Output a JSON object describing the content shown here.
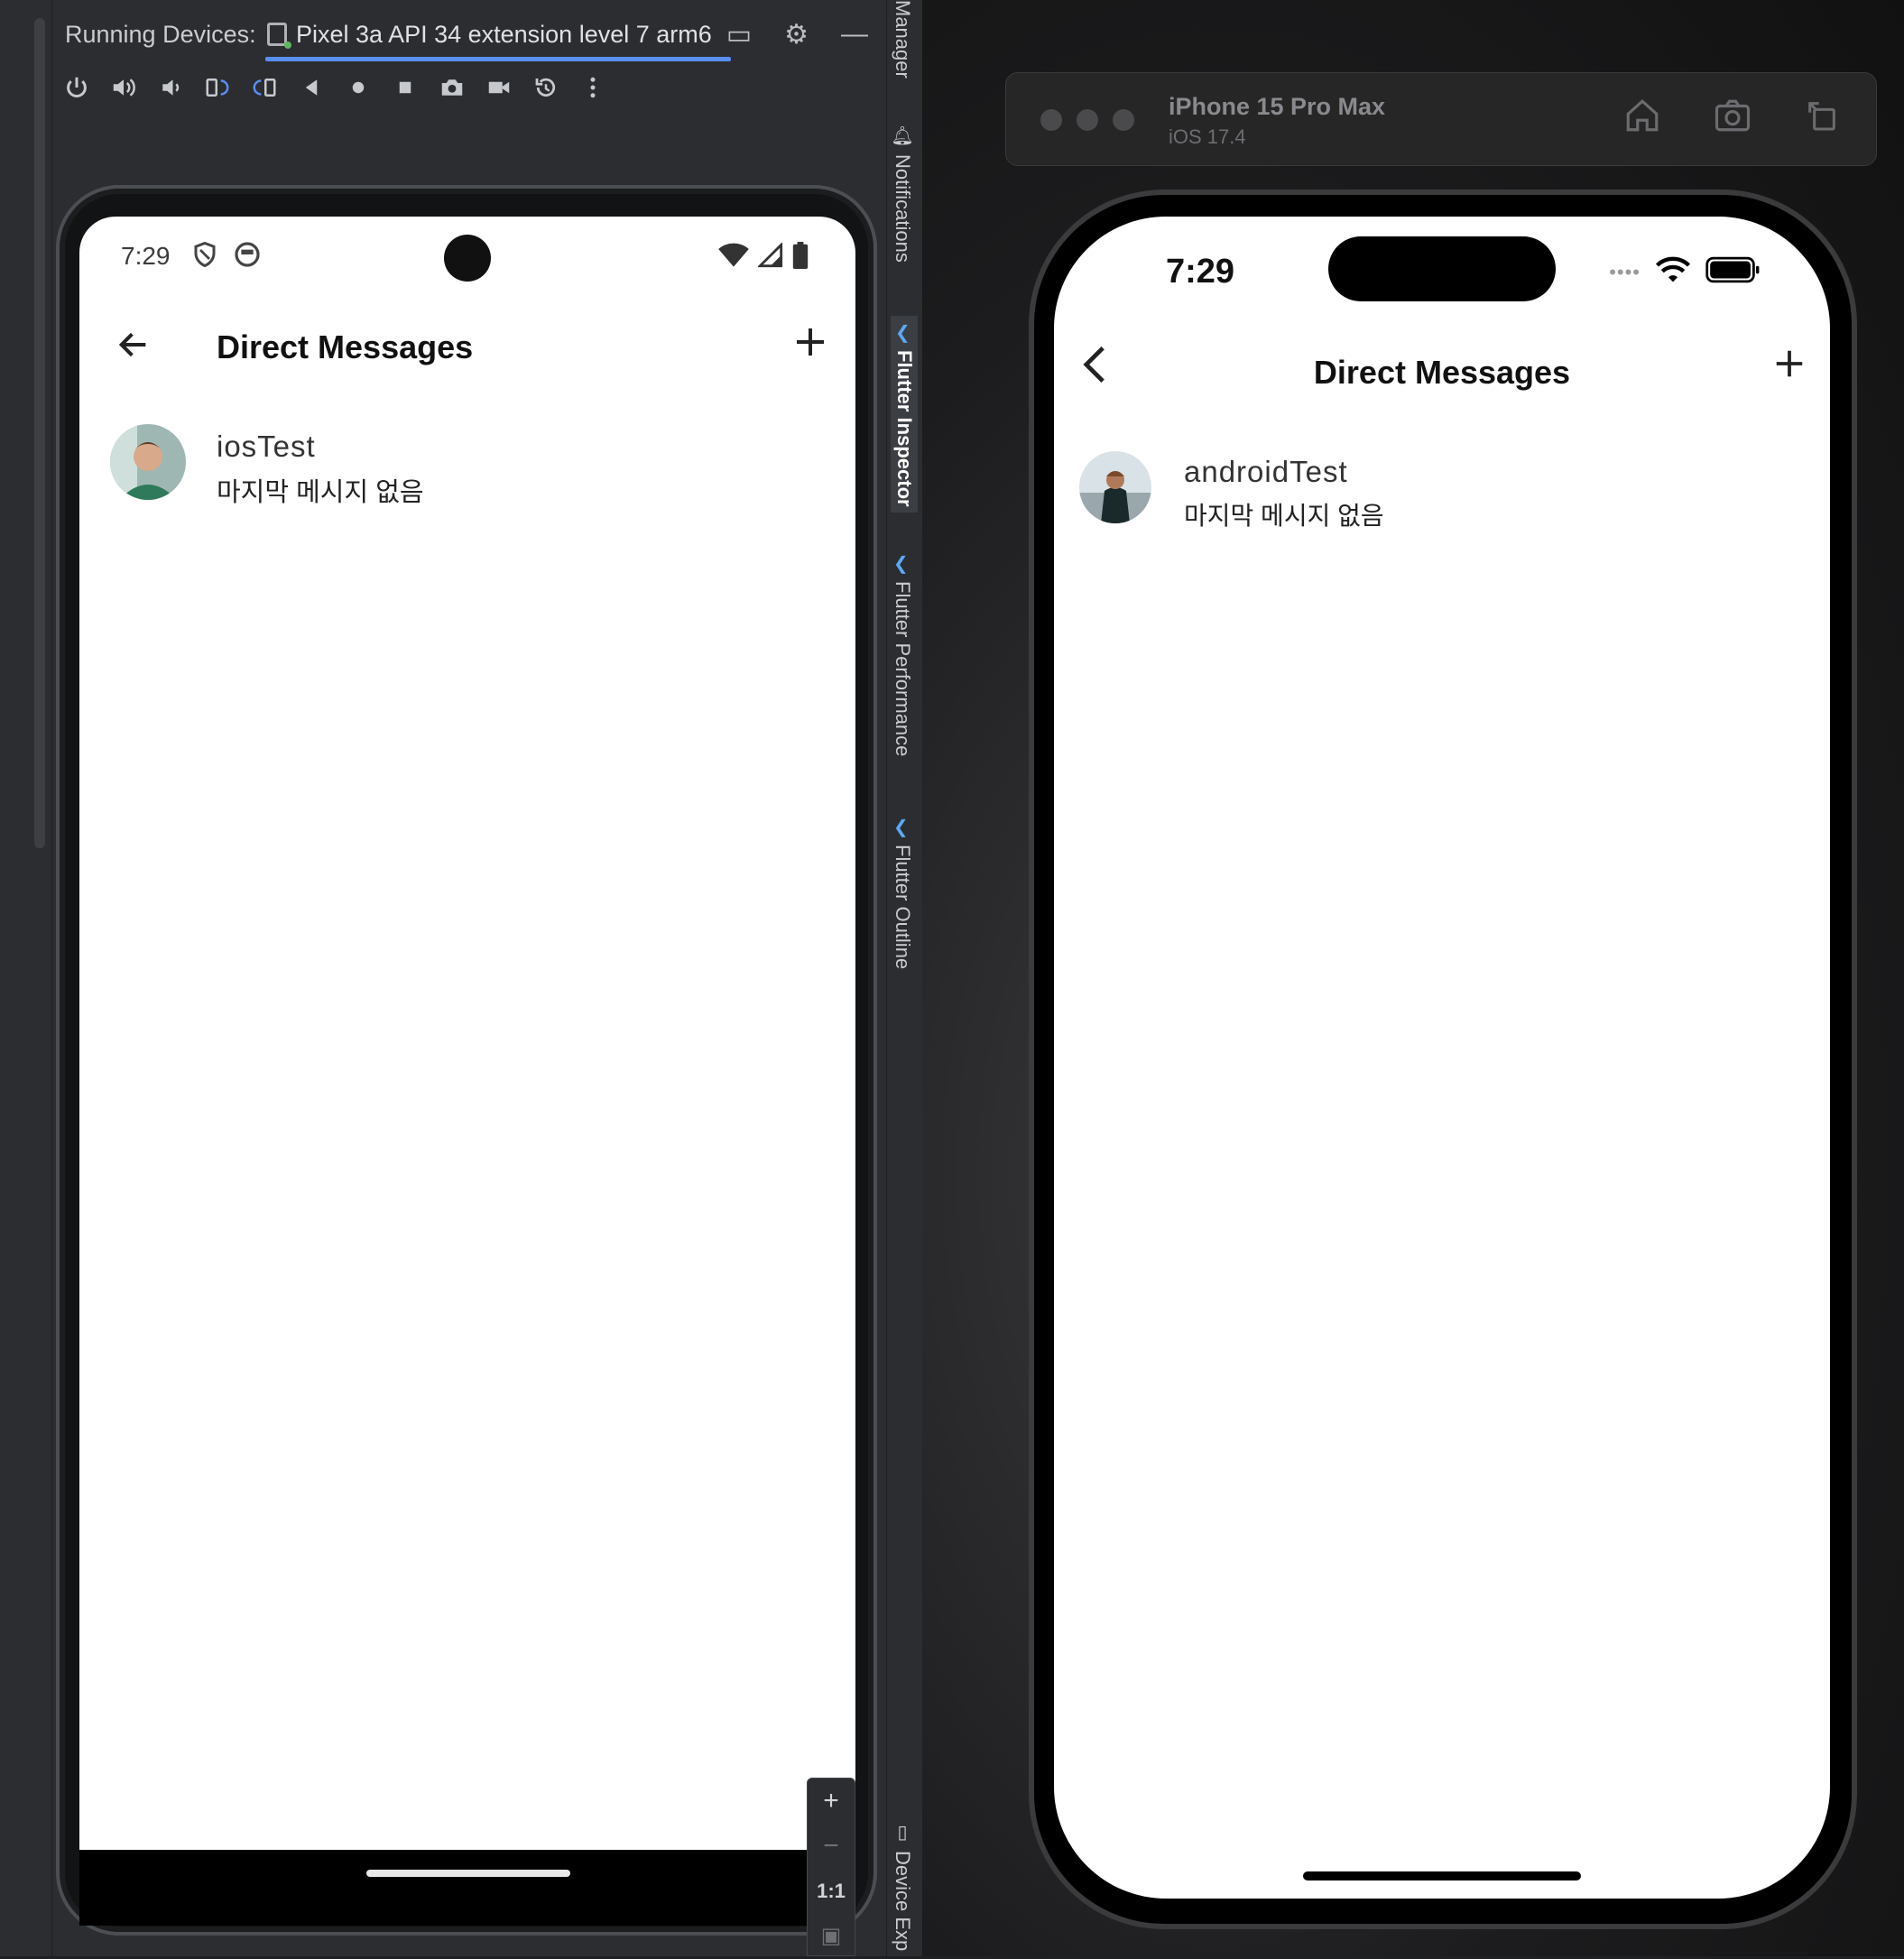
{
  "ide": {
    "running_devices_label": "Running Devices:",
    "device_tab": "Pixel 3a API 34 extension level 7 arm6",
    "tool_tabs": {
      "manager": "Manager",
      "notifications": "Notifications",
      "flutter_inspector": "Flutter Inspector",
      "flutter_performance": "Flutter Performance",
      "flutter_outline": "Flutter Outline",
      "device_explorer": "Device Exp"
    },
    "toolbar_icons": [
      "power-icon",
      "volume-up-icon",
      "volume-down-icon",
      "rotate-left-icon",
      "rotate-right-icon",
      "back-icon",
      "home-icon",
      "overview-icon",
      "screenshot-icon",
      "screen-record-icon",
      "snapshot-icon",
      "more-icon"
    ],
    "zoom": {
      "plus": "+",
      "minus": "−",
      "actual": "1:1"
    }
  },
  "android": {
    "status_time": "7:29",
    "title": "Direct Messages",
    "chat": {
      "name": "iosTest",
      "last_message": "마지막 메시지 없음"
    }
  },
  "simulator": {
    "device_name": "iPhone 15 Pro Max",
    "os_version": "iOS 17.4",
    "status_time": "7:29",
    "title": "Direct Messages",
    "chat": {
      "name": "androidTest",
      "last_message": "마지막 메시지 없음"
    }
  },
  "colors": {
    "ide_bg": "#2b2d30",
    "tab_underline": "#5a8ef2",
    "screen_bg": "#ffffff"
  }
}
